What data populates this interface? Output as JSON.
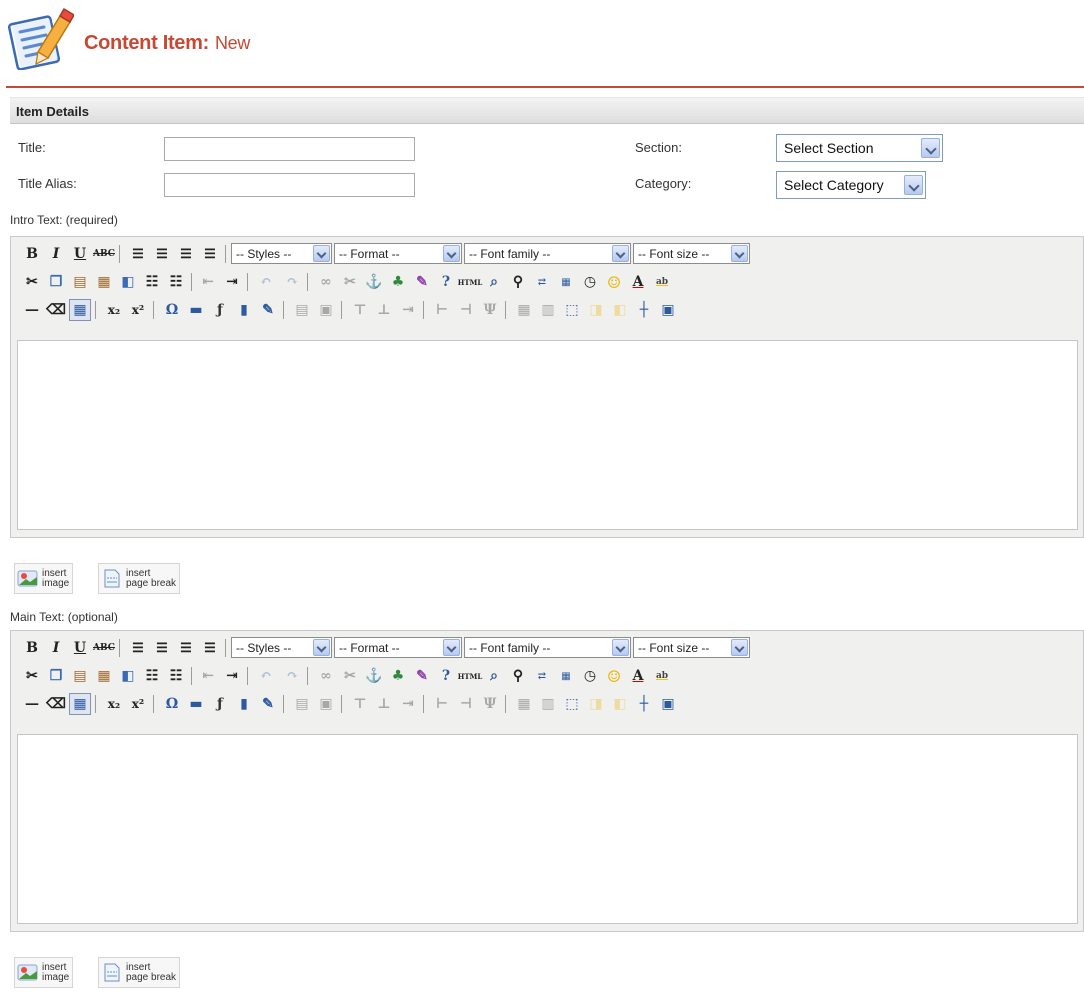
{
  "header": {
    "title": "Content Item:",
    "subtitle": "New",
    "icon": "edit-document-icon",
    "accent_color": "#c64934"
  },
  "details": {
    "heading": "Item Details",
    "title_label": "Title:",
    "title_value": "",
    "alias_label": "Title Alias:",
    "alias_value": "",
    "section_label": "Section:",
    "section_value": "Select Section",
    "category_label": "Category:",
    "category_value": "Select Category"
  },
  "intro": {
    "label": "Intro Text: (required)"
  },
  "main": {
    "label": "Main Text: (optional)"
  },
  "toolbar": {
    "styles": "-- Styles --",
    "format": "-- Format --",
    "font_family": "-- Font family --",
    "font_size": "-- Font size --"
  },
  "buttons": {
    "insert_image": [
      "insert",
      "image"
    ],
    "insert_pagebreak": [
      "insert",
      "page break"
    ]
  }
}
